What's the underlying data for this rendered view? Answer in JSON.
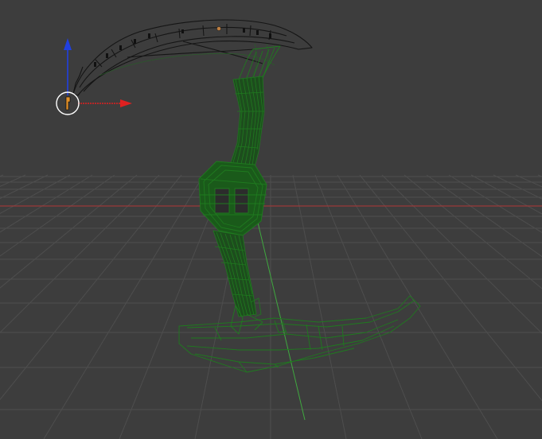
{
  "viewport": {
    "background": "#3d3d3d",
    "grid_color": "#4e4e4e",
    "x_axis_color": "#9a3a3a",
    "y_axis_color": "#3fa83f",
    "mesh_color": "#1f7a1f",
    "mesh_dark_color": "#151515",
    "selected_mesh_color": "#000000",
    "gizmo": {
      "x_axis_color": "#e02020",
      "z_axis_color": "#2040e0",
      "origin_ring_color": "#ffffff",
      "origin_color": "#e0902a"
    }
  },
  "object": {
    "name": "scythe",
    "mode": "wireframe"
  }
}
